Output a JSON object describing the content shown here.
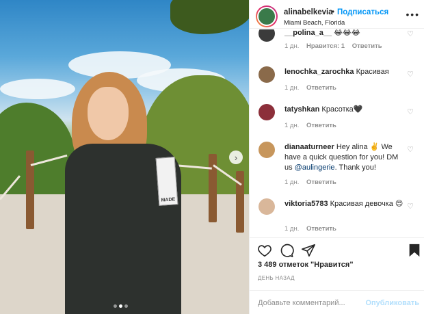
{
  "post": {
    "username": "alinabelkevia",
    "separator": "•",
    "follow_label": "Подписаться",
    "location": "Miami Beach, Florida",
    "more_icon": "more-horizontal-icon",
    "photo_patch_text": "MADE",
    "next_arrow": "›"
  },
  "comments": [
    {
      "username": "__polina_a__",
      "text": "😂😂😂",
      "time": "1 дн.",
      "likes": "Нравится: 1",
      "reply": "Ответить",
      "avatar_color": "#3b3b3b"
    },
    {
      "username": "lenochka_zarochka",
      "text": "Красивая",
      "time": "1 дн.",
      "likes": "",
      "reply": "Ответить",
      "avatar_color": "#8a6a4a"
    },
    {
      "username": "tatyshkan",
      "text": "Красотка🖤",
      "time": "1 дн.",
      "likes": "",
      "reply": "Ответить",
      "avatar_color": "#8c2f3a"
    },
    {
      "username": "dianaaturneer",
      "text_pre": "Hey alina ✌️ We have a quick question for you! DM us ",
      "mention": "@aulingerie",
      "text_post": ". Thank you!",
      "time": "1 дн.",
      "likes": "",
      "reply": "Ответить",
      "avatar_color": "#c7965c"
    },
    {
      "username": "viktoria5783",
      "text": "Красивая девочка 😍",
      "time": "1 дн.",
      "likes": "",
      "reply": "Ответить",
      "avatar_color": "#d9b79a"
    }
  ],
  "actions": {
    "likes_text": "3 489 отметок \"Нравится\"",
    "time_ago": "ДЕНЬ НАЗАД"
  },
  "add_comment": {
    "placeholder": "Добавьте комментарий...",
    "publish_label": "Опубликовать"
  },
  "colors": {
    "accent": "#0095f6",
    "publish_disabled": "#b2dffc",
    "muted": "#8e8e8e"
  }
}
